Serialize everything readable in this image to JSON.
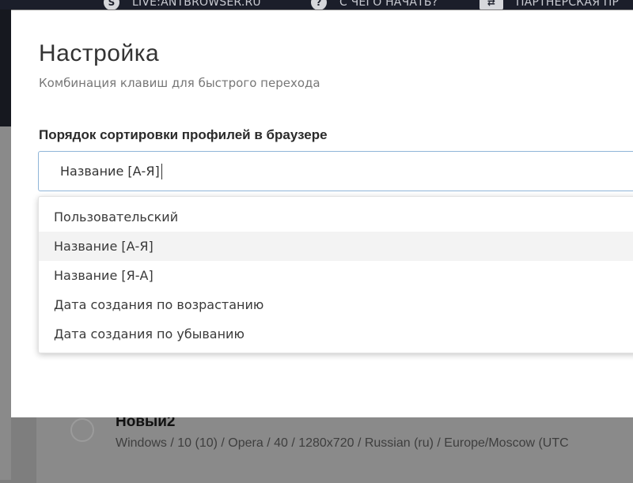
{
  "topbar": {
    "links": [
      {
        "icon": "skype-icon",
        "glyph": "S",
        "label": "LIVE:ANTBROWSER.RU"
      },
      {
        "icon": "question-icon",
        "glyph": "?",
        "label": "С ЧЕГО НАЧАТЬ?"
      },
      {
        "icon": "partner-icon",
        "glyph": "⇄",
        "label": "ПАРТНЕРСКАЯ ПР"
      }
    ]
  },
  "modal": {
    "title": "Настройка",
    "subtitle": "Комбинация клавиш для быстрого перехода",
    "sort_label": "Порядок сортировки профилей в браузере",
    "sort_value": "Название [А-Я]",
    "options": [
      "Пользовательский",
      "Название [А-Я]",
      "Название [Я-А]",
      "Дата создания по возрастанию",
      "Дата создания по убыванию"
    ],
    "selected_option": "Название [А-Я]"
  },
  "background_profile": {
    "name": "Новый2",
    "info": "Windows / 10 (10) / Opera / 40 / 1280x720 / Russian (ru) / Europe/Moscow (UTC"
  }
}
